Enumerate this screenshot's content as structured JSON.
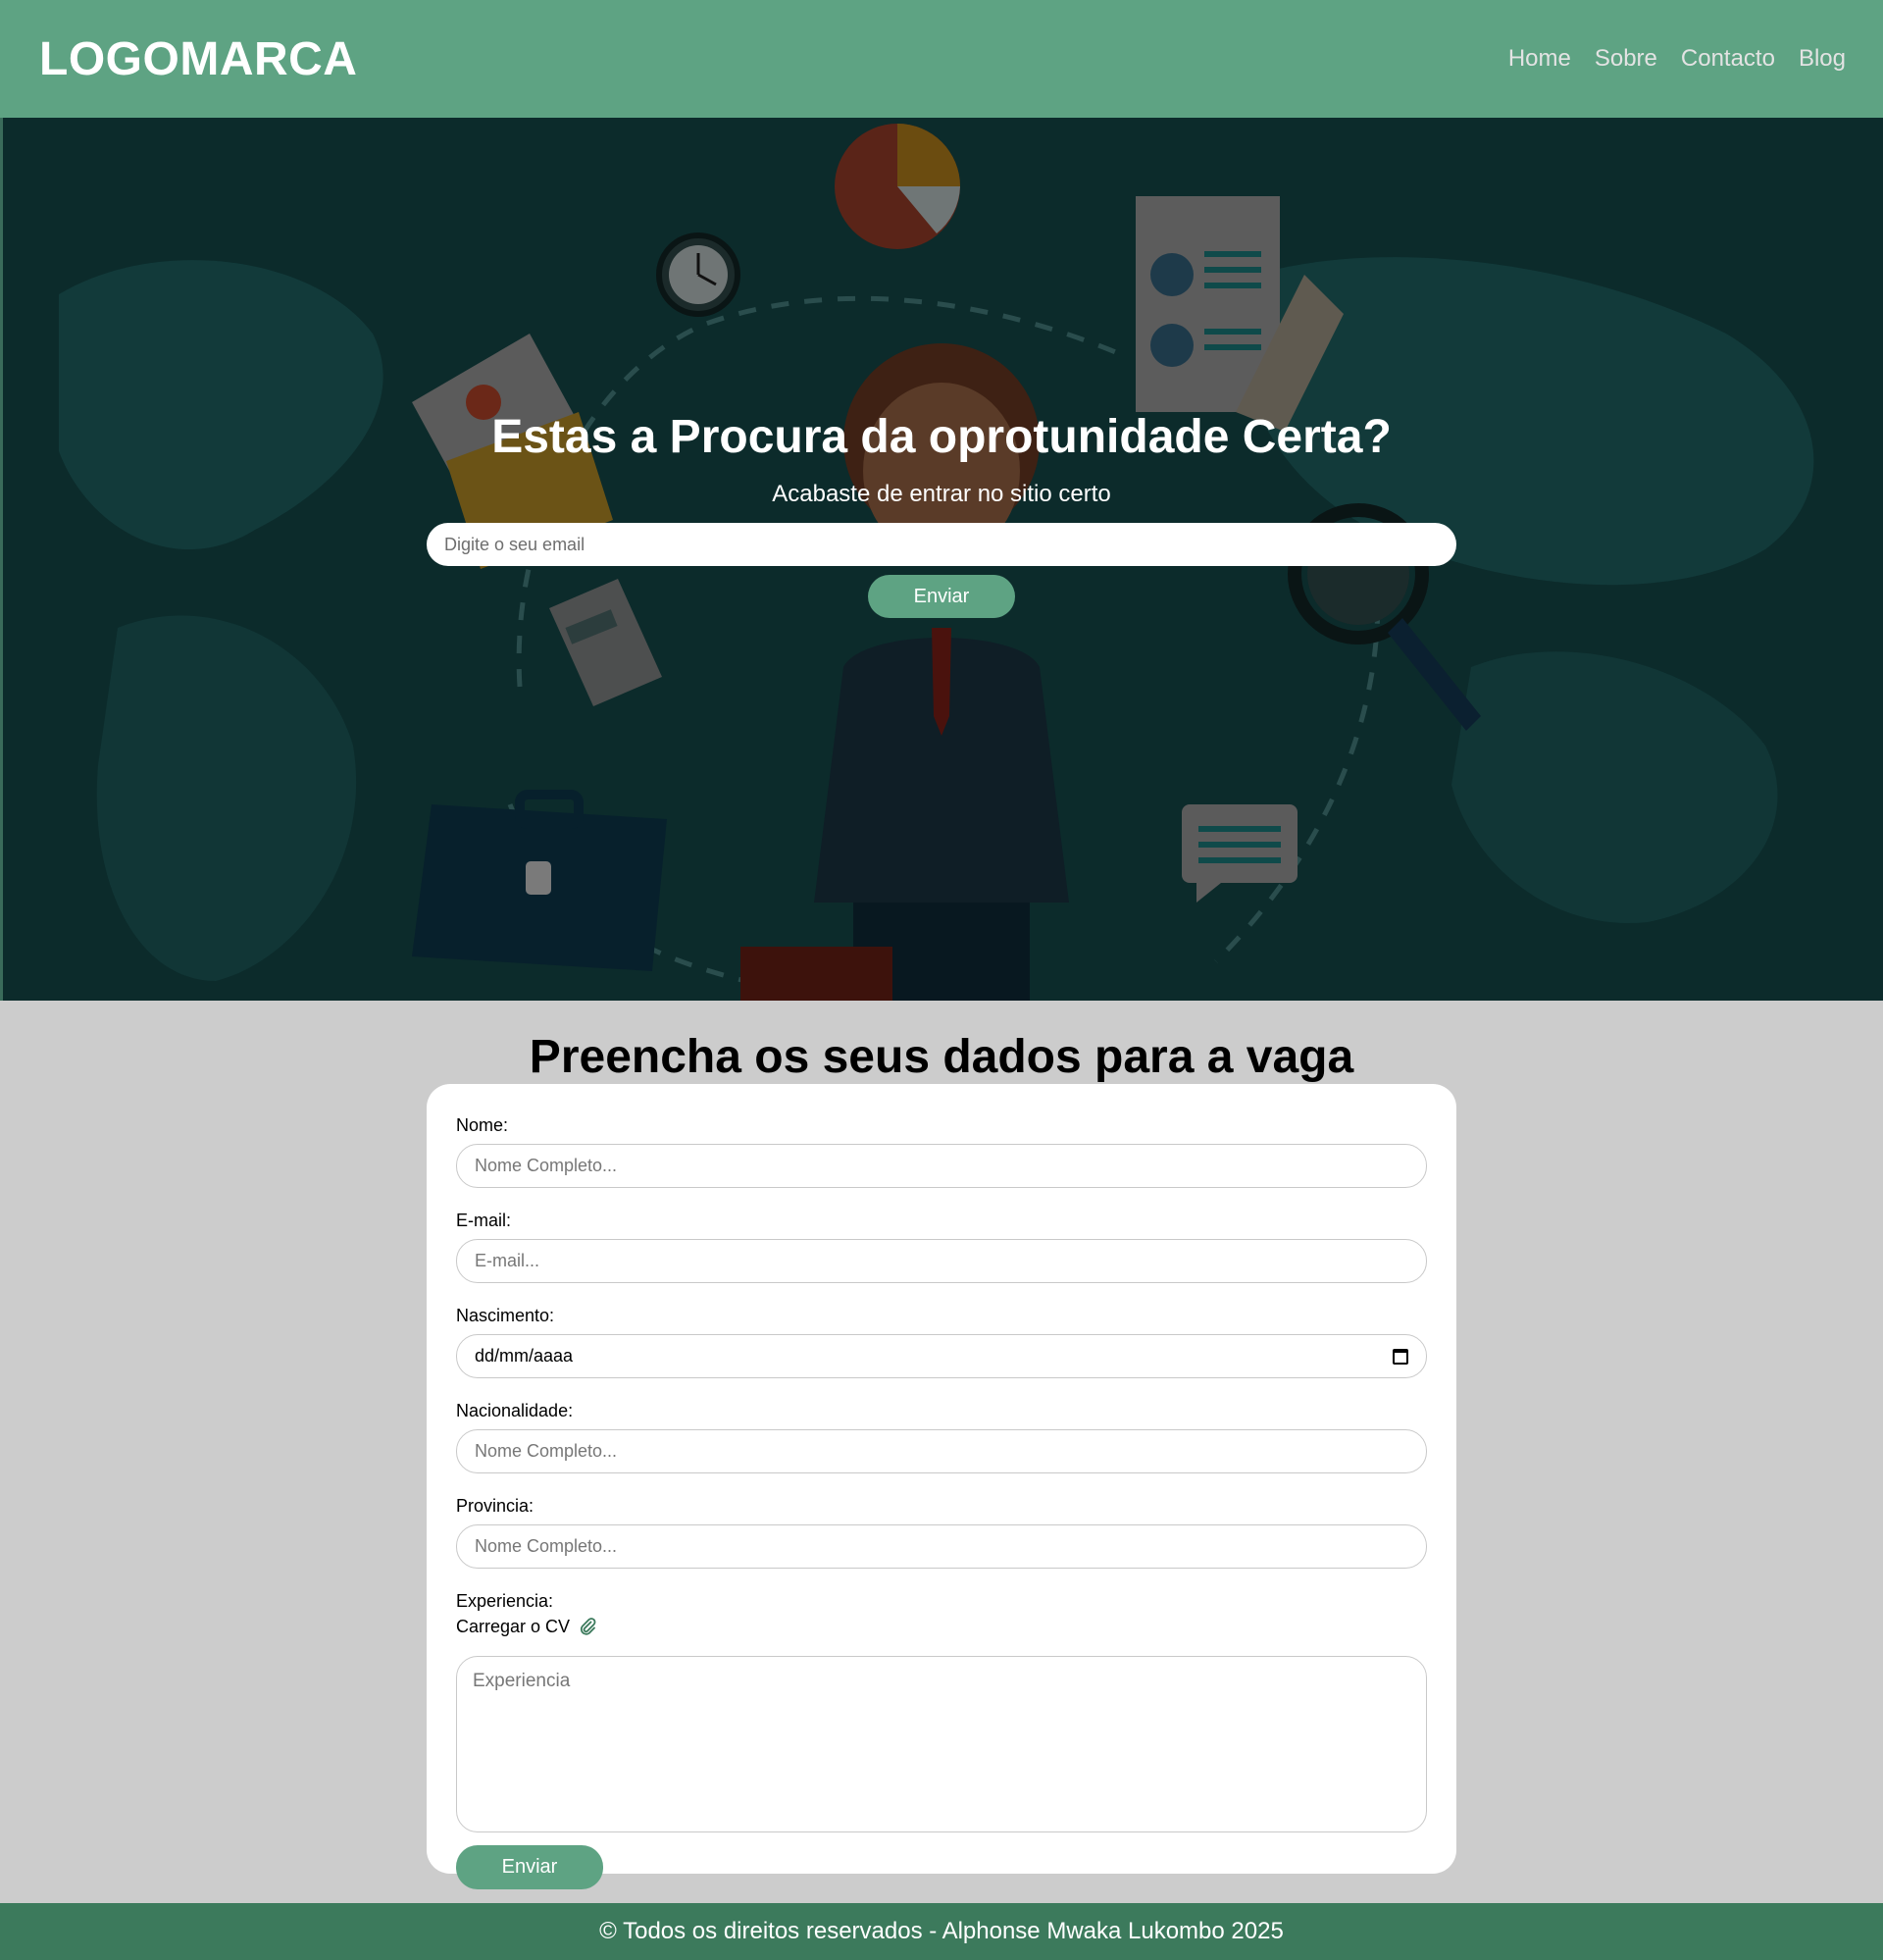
{
  "header": {
    "logo": "LOGOMARCA",
    "nav": [
      "Home",
      "Sobre",
      "Contacto",
      "Blog"
    ]
  },
  "hero": {
    "title": "Estas a Procura da oprotunidade Certa?",
    "subtitle": "Acabaste de entrar no sitio certo",
    "email_placeholder": "Digite o seu email",
    "button_label": "Enviar"
  },
  "form": {
    "title": "Preencha os seus dados para a vaga",
    "fields": {
      "nome_label": "Nome:",
      "nome_placeholder": "Nome Completo...",
      "email_label": "E-mail:",
      "email_placeholder": "E-mail...",
      "nascimento_label": "Nascimento:",
      "nascimento_value": "dd/mm/aaaa",
      "nacionalidade_label": "Nacionalidade:",
      "nacionalidade_placeholder": "Nome Completo...",
      "provincia_label": "Provincia:",
      "provincia_placeholder": "Nome Completo...",
      "experiencia_label": "Experiencia:",
      "cv_label": "Carregar o CV",
      "experiencia_placeholder": "Experiencia"
    },
    "submit_label": "Enviar"
  },
  "footer": {
    "text": "© Todos os direitos reservados - Alphonse Mwaka Lukombo 2025"
  },
  "colors": {
    "brand_green": "#5ea383",
    "footer_green": "#3c7a5c",
    "hero_overlay": "#0b2a2a",
    "page_bg": "#cccccc"
  },
  "icons": [
    "calendar-icon",
    "paperclip-icon"
  ]
}
